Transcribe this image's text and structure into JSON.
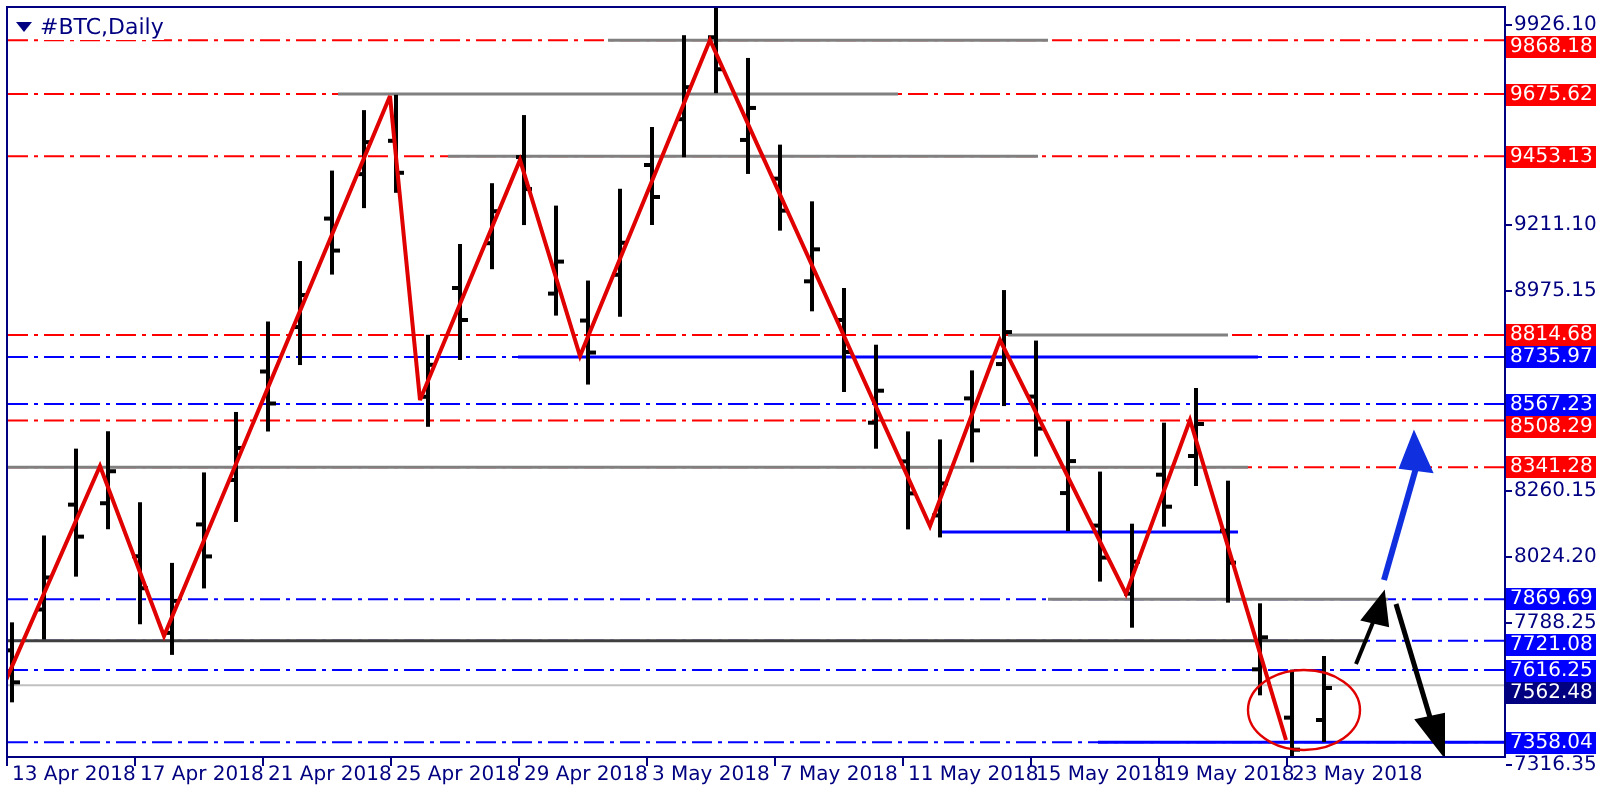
{
  "chart": {
    "title": "#BTC,Daily"
  },
  "price_axis": {
    "ticks": [
      "9926.10",
      "9211.10",
      "8975.15",
      "8260.15",
      "8024.20",
      "7788.25",
      "7316.35"
    ]
  },
  "levels": [
    {
      "price": "9868.18",
      "kind": "level",
      "color": "#ff0000"
    },
    {
      "price": "9675.62",
      "kind": "level",
      "color": "#ff0000"
    },
    {
      "price": "9453.13",
      "kind": "level",
      "color": "#ff0000"
    },
    {
      "price": "8814.68",
      "kind": "level",
      "color": "#ff0000"
    },
    {
      "price": "8735.97",
      "kind": "level",
      "color": "#0000ff"
    },
    {
      "price": "8567.23",
      "kind": "level",
      "color": "#0000ff"
    },
    {
      "price": "8508.29",
      "kind": "level",
      "color": "#ff0000"
    },
    {
      "price": "8341.28",
      "kind": "level",
      "color": "#ff0000"
    },
    {
      "price": "7869.69",
      "kind": "level",
      "color": "#0000ff"
    },
    {
      "price": "7721.08",
      "kind": "level",
      "color": "#0000ff"
    },
    {
      "price": "7616.25",
      "kind": "level",
      "color": "#0000ff"
    },
    {
      "price": "7562.48",
      "kind": "current",
      "color": "#000080"
    },
    {
      "price": "7358.04",
      "kind": "level",
      "color": "#0000ff"
    }
  ],
  "time_axis": {
    "ticks": [
      "13 Apr 2018",
      "17 Apr 2018",
      "21 Apr 2018",
      "25 Apr 2018",
      "29 Apr 2018",
      "3 May 2018",
      "7 May 2018",
      "11 May 2018",
      "15 May 2018",
      "19 May 2018",
      "23 May 2018"
    ]
  }
}
